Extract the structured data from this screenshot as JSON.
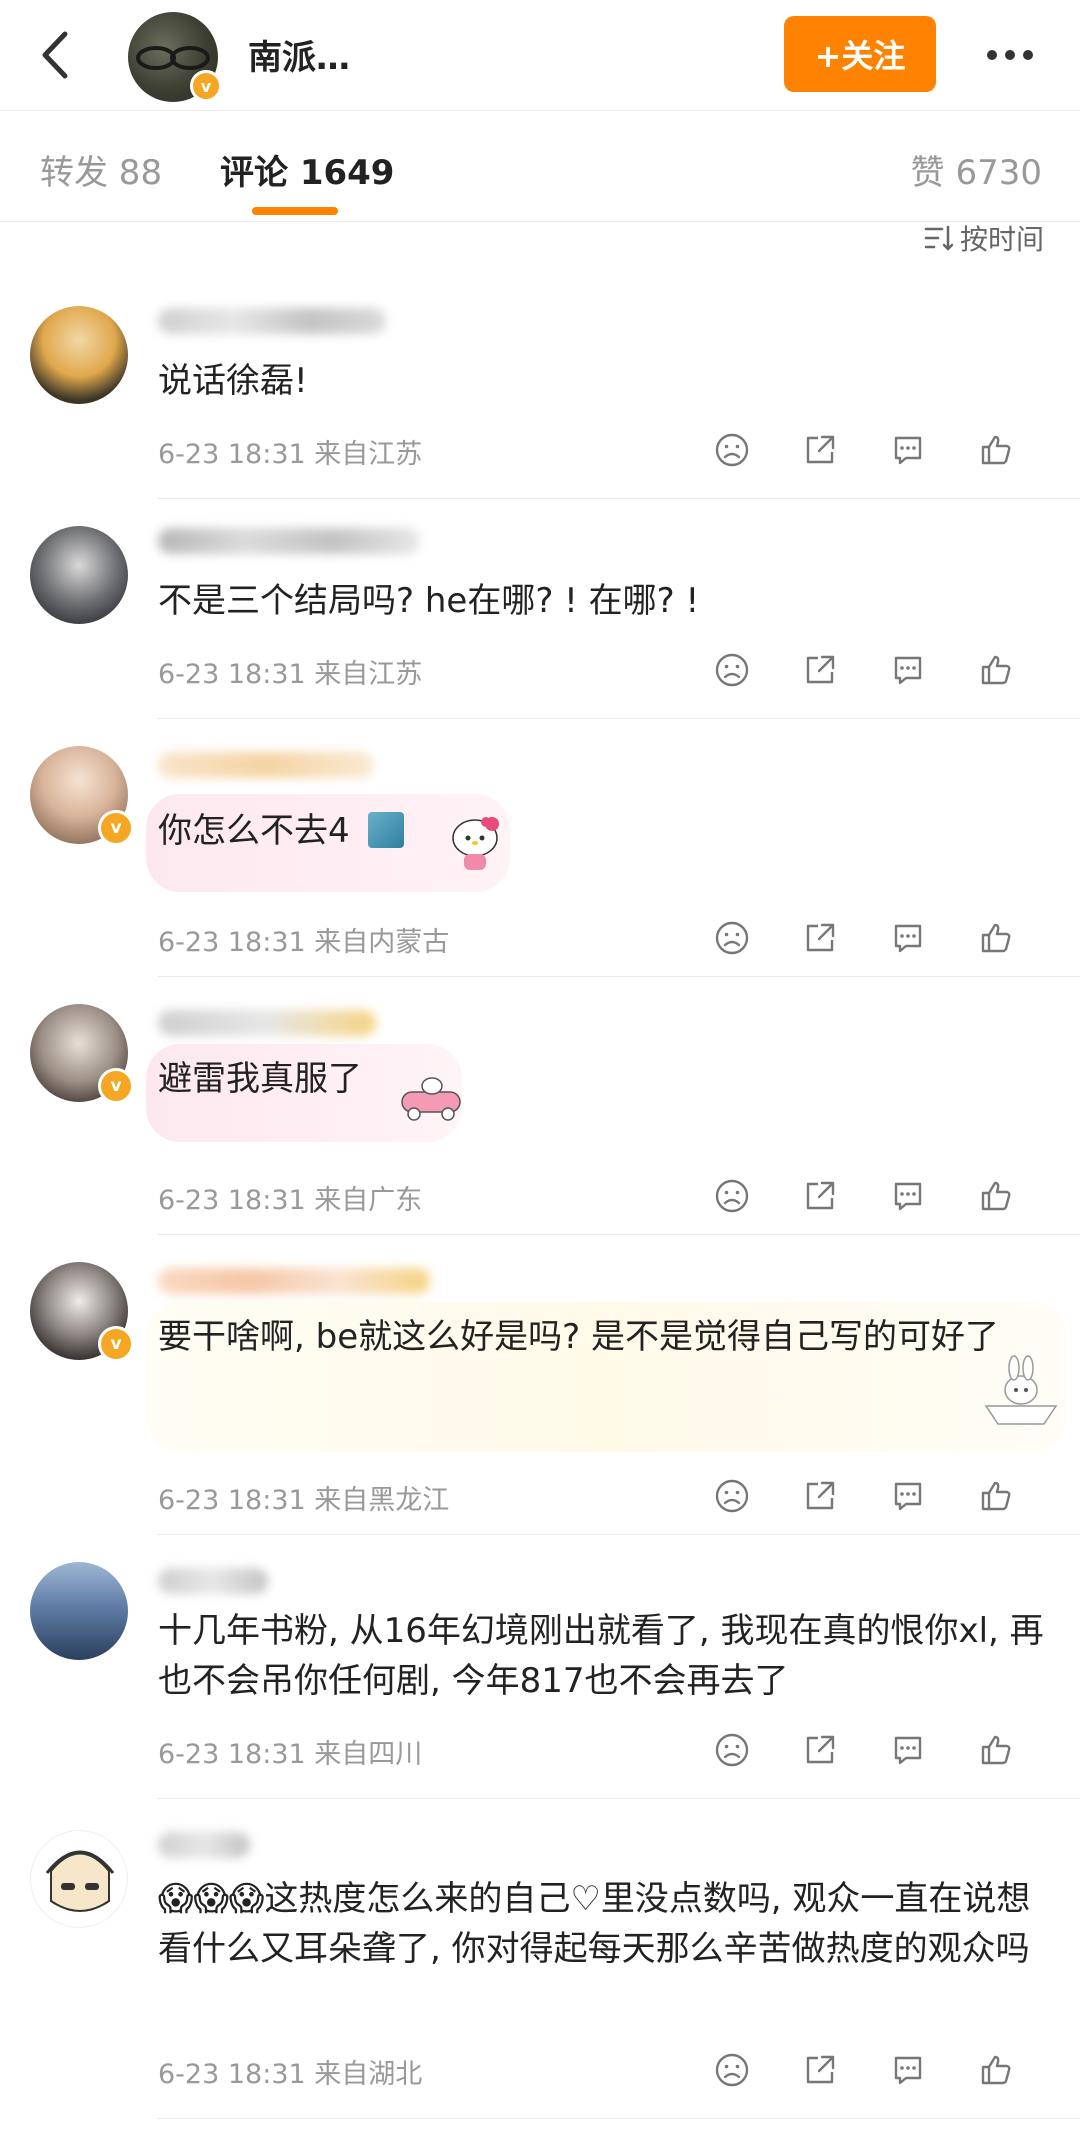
{
  "header": {
    "back_icon": "chevron-left-icon",
    "name": "南派…",
    "follow_label": "+关注",
    "more_icon": "more-dots-icon",
    "verified_icon": "v"
  },
  "tabs": {
    "repost": "转发 88",
    "comment": "评论 1649",
    "like": "赞 6730",
    "active_color": "#ff8200"
  },
  "sort_label": "按时间",
  "comments": [
    {
      "text": "说话徐磊!",
      "meta": "6-23 18:31 来自江苏"
    },
    {
      "text": "不是三个结局吗? he在哪? ! 在哪? !",
      "meta": "6-23 18:31 来自江苏"
    },
    {
      "text": "你怎么不去4",
      "meta": "6-23 18:31 来自内蒙古"
    },
    {
      "text": "避雷我真服了",
      "meta": "6-23 18:31 来自广东"
    },
    {
      "text": "要干啥啊, be就这么好是吗? 是不是觉得自己写的可好了",
      "meta": "6-23 18:31 来自黑龙江"
    },
    {
      "text": "十几年书粉, 从16年幻境刚出就看了, 我现在真的恨你xl, 再也不会吊你任何剧, 今年817也不会再去了",
      "meta": "6-23 18:31 来自四川"
    },
    {
      "text": "😱😱😱这热度怎么来的自己♡里没点数吗, 观众一直在说想看什么又耳朵聋了, 你对得起每天那么辛苦做热度的观众吗",
      "meta": "6-23 18:31 来自湖北"
    }
  ],
  "action_icons": [
    "dislike-face-icon",
    "share-icon",
    "comment-icon",
    "like-thumb-icon"
  ]
}
